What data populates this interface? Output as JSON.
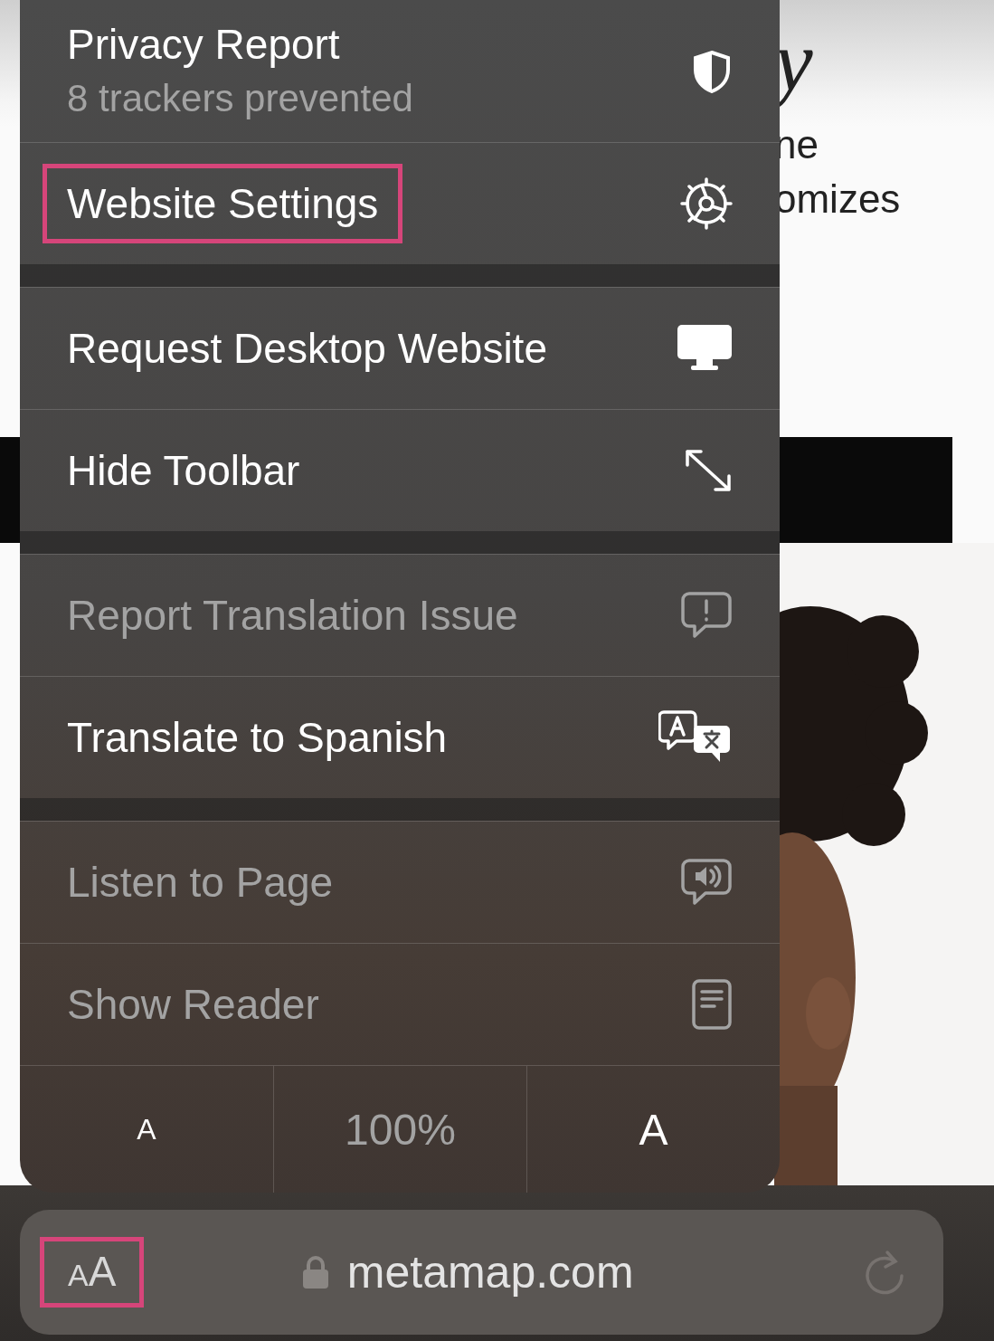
{
  "page": {
    "heading_fragment": "y",
    "text_fragments": [
      "ne",
      "omizes"
    ]
  },
  "menu": {
    "groups": [
      {
        "items": [
          {
            "label": "Privacy Report",
            "subtitle": "8 trackers prevented",
            "disabled": false,
            "highlighted": false
          },
          {
            "label": "Website Settings",
            "disabled": false,
            "highlighted": true
          }
        ]
      },
      {
        "items": [
          {
            "label": "Request Desktop Website",
            "disabled": false,
            "highlighted": false
          },
          {
            "label": "Hide Toolbar",
            "disabled": false,
            "highlighted": false
          }
        ]
      },
      {
        "items": [
          {
            "label": "Report Translation Issue",
            "disabled": true,
            "highlighted": false
          },
          {
            "label": "Translate to Spanish",
            "disabled": false,
            "highlighted": false
          }
        ]
      },
      {
        "items": [
          {
            "label": "Listen to Page",
            "disabled": true,
            "highlighted": false
          },
          {
            "label": "Show Reader",
            "disabled": true,
            "highlighted": false
          }
        ]
      }
    ],
    "zoom": {
      "decrease": "A",
      "level": "100%",
      "increase": "A"
    }
  },
  "address_bar": {
    "text_size_button": "AA",
    "highlighted": true,
    "url": "metamap.com"
  }
}
